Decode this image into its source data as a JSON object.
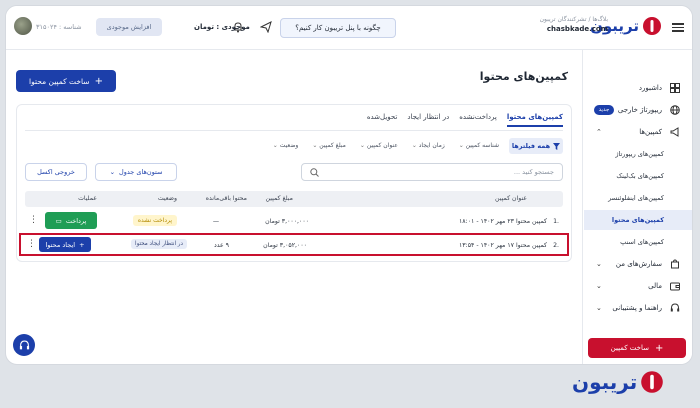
{
  "header": {
    "store_breadcrumb": "بلاگ‌ها / تشرکنندگان تریبون",
    "store_name": "chasbkade.com",
    "help_label": "چگونه با پنل تریبون کار کنیم؟",
    "balance_label": "موجودی : تومان",
    "topup_label": "افزایش موجودی",
    "shop_id": "شناسه : ۳۱۵۰۲۴",
    "logo_text": "تریبون"
  },
  "sidebar": {
    "items": [
      {
        "label": "داشبورد",
        "icon": "dashboard-icon"
      },
      {
        "label": "ریپورتاژ خارجی",
        "icon": "globe-icon",
        "badge": "جدید"
      },
      {
        "label": "کمپین‌ها",
        "icon": "megaphone-icon"
      }
    ],
    "subitems": [
      {
        "label": "کمپین‌های ریپورتاژ"
      },
      {
        "label": "کمپین‌های بک‌لینک"
      },
      {
        "label": "کمپین‌های اینفلوئنسر"
      },
      {
        "label": "کمپین‌های محتوا",
        "active": true
      },
      {
        "label": "کمپین‌های اسنپ"
      }
    ],
    "lower_items": [
      {
        "label": "سفارش‌های من",
        "icon": "bag-icon"
      },
      {
        "label": "مالی",
        "icon": "wallet-icon"
      },
      {
        "label": "راهنما و پشتیبانی",
        "icon": "headset-icon"
      }
    ],
    "cta_label": "ساخت کمپین"
  },
  "main": {
    "title": "کمپین‌های محتوا",
    "build_button": "ساخت کمپین محتوا",
    "tabs": [
      {
        "label": "کمپین‌های محتوا",
        "active": true
      },
      {
        "label": "پرداخت‌نشده"
      },
      {
        "label": "در انتظار ایجاد"
      },
      {
        "label": "تحویل‌شده"
      }
    ],
    "filters_button": "همه فیلترها",
    "filter_chips": [
      "شناسه کمپین",
      "زمان ایجاد",
      "عنوان کمپین",
      "مبلغ کمپین",
      "وضعیت"
    ],
    "search_placeholder": "جستجو کنید ...",
    "columns_button": "ستون‌های جدول",
    "excel_button": "خروجی اکسل",
    "table": {
      "headers": [
        "عنوان کمپین",
        "مبلغ کمپین",
        "محتوا باقی‌مانده",
        "وضعیت",
        "عملیات"
      ],
      "rows": [
        {
          "index": ".1",
          "title": "کمپین محتوا ۲۳ مهر ۱۴۰۲ - ۱۸:۰۱",
          "amount": "۳,۰۰۰,۰۰۰ تومان",
          "remaining": "—",
          "status": "پرداخت نشده",
          "action": "پرداخت"
        },
        {
          "index": ".2",
          "title": "کمپین محتوا ۱۷ مهر ۱۴۰۲ - ۱۳:۵۴",
          "amount": "۳,۰۵۲,۰۰۰ تومان",
          "remaining": "۹ عدد",
          "status": "در انتظار ایجاد محتوا",
          "action": "ایجاد محتوا"
        }
      ]
    }
  },
  "footer": {
    "logo_text": "تریبون"
  },
  "colors": {
    "brand_blue": "#1c3faa",
    "brand_red": "#c8102e",
    "pay_green": "#1f9d55"
  }
}
